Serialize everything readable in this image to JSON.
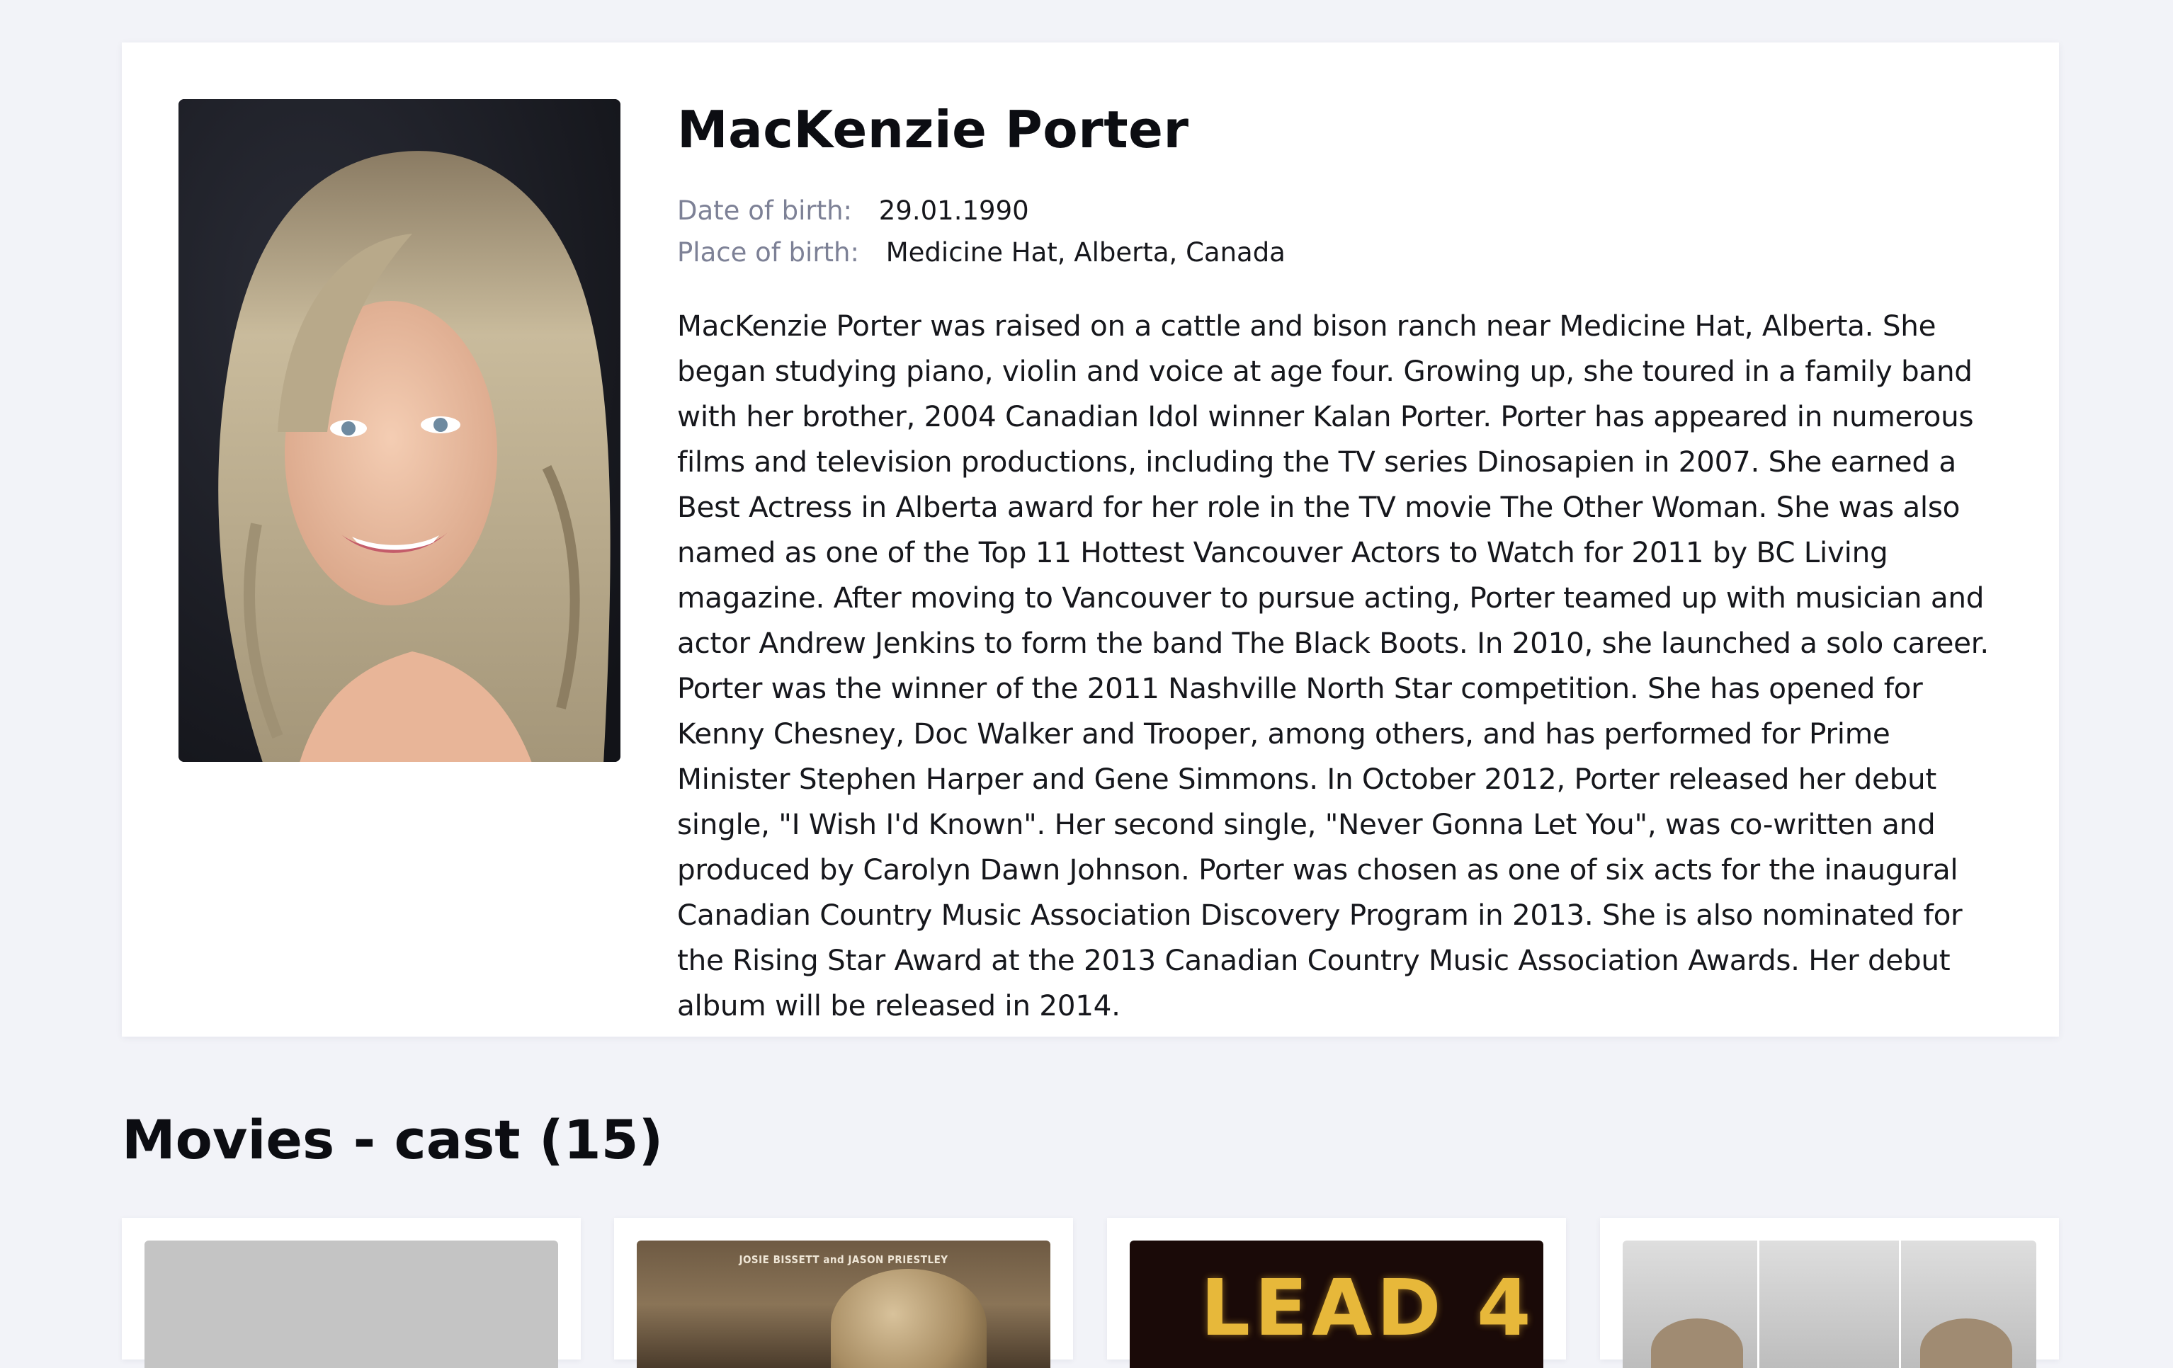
{
  "profile": {
    "name": "MacKenzie Porter",
    "facts": [
      {
        "label": "Date of birth:",
        "value": "29.01.1990"
      },
      {
        "label": "Place of birth:",
        "value": "Medicine Hat, Alberta, Canada"
      }
    ],
    "bio": "MacKenzie Porter was raised on a cattle and bison ranch near Medicine Hat, Alberta. She began studying piano, violin and voice at age four. Growing up, she toured in a family band with her brother, 2004 Canadian Idol winner Kalan Porter. Porter has appeared in numerous films and television productions, including the TV series Dinosapien in 2007. She earned a Best Actress in Alberta award for her role in the TV movie The Other Woman. She was also named as one of the Top 11 Hottest Vancouver Actors to Watch for 2011 by BC Living magazine. After moving to Vancouver to pursue acting, Porter teamed up with musician and actor Andrew Jenkins to form the band The Black Boots. In 2010, she launched a solo career. Porter was the winner of the 2011 Nashville North Star competition. She has opened for Kenny Chesney, Doc Walker and Trooper, among others, and has performed for Prime Minister Stephen Harper and Gene Simmons. In October 2012, Porter released her debut single, \"I Wish I'd Known\". Her second single, \"Never Gonna Let You\", was co-written and produced by Carolyn Dawn Johnson. Porter was chosen as one of six acts for the inaugural Canadian Country Music Association Discovery Program in 2013. She is also nominated for the Rising Star Award at the 2013 Canadian Country Music Association Awards. Her debut album will be released in 2014."
  },
  "movies": {
    "section_title": "Movies - cast (15)",
    "posters": [
      {
        "kind": "placeholder"
      },
      {
        "kind": "image",
        "credit_text": "JOSIE BISSETT and JASON PRIESTLEY"
      },
      {
        "kind": "image",
        "title_text": "LEAD 4"
      },
      {
        "kind": "image"
      }
    ]
  }
}
